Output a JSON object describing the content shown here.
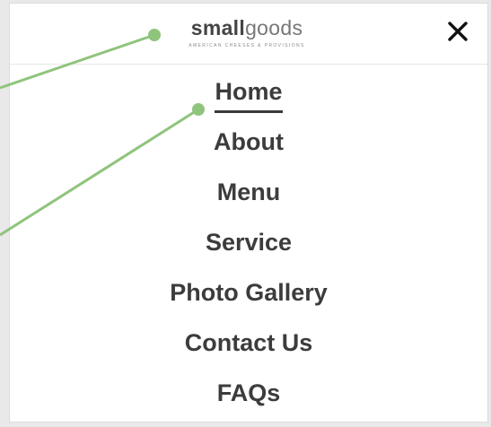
{
  "logo": {
    "name_bold": "small",
    "name_light": "goods",
    "tagline": "AMERICAN CHEESES & PROVISIONS"
  },
  "header": {
    "close_icon": "close-icon"
  },
  "nav": {
    "items": [
      {
        "label": "Home",
        "active": true
      },
      {
        "label": "About"
      },
      {
        "label": "Menu"
      },
      {
        "label": "Service"
      },
      {
        "label": "Photo Gallery"
      },
      {
        "label": "Contact Us"
      },
      {
        "label": "FAQs"
      }
    ]
  },
  "colors": {
    "callout": "#8fc47c",
    "text": "#3c3c3c",
    "background": "#e9e9e9"
  }
}
